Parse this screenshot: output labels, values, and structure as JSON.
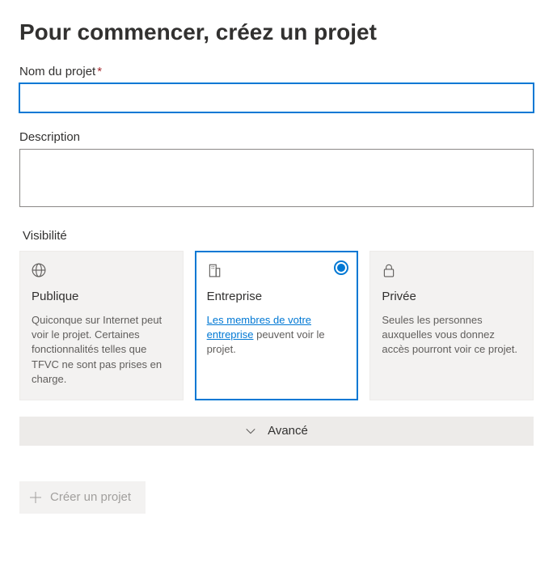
{
  "heading": "Pour commencer, créez un projet",
  "projectName": {
    "label": "Nom du projet",
    "value": ""
  },
  "description": {
    "label": "Description",
    "value": ""
  },
  "visibility": {
    "label": "Visibilité",
    "options": [
      {
        "title": "Publique",
        "desc_before": "Quiconque sur Internet peut voir le projet. Certaines fonctionnalités telles que TFVC ne sont pas prises en charge.",
        "selected": false
      },
      {
        "title": "Entreprise",
        "link_text": "Les membres de votre entreprise",
        "desc_after": " peuvent voir le projet.",
        "selected": true
      },
      {
        "title": "Privée",
        "desc_before": "Seules les personnes auxquelles vous donnez accès pourront voir ce projet.",
        "selected": false
      }
    ]
  },
  "advanced_label": "Avancé",
  "create_button": "Créer un projet"
}
